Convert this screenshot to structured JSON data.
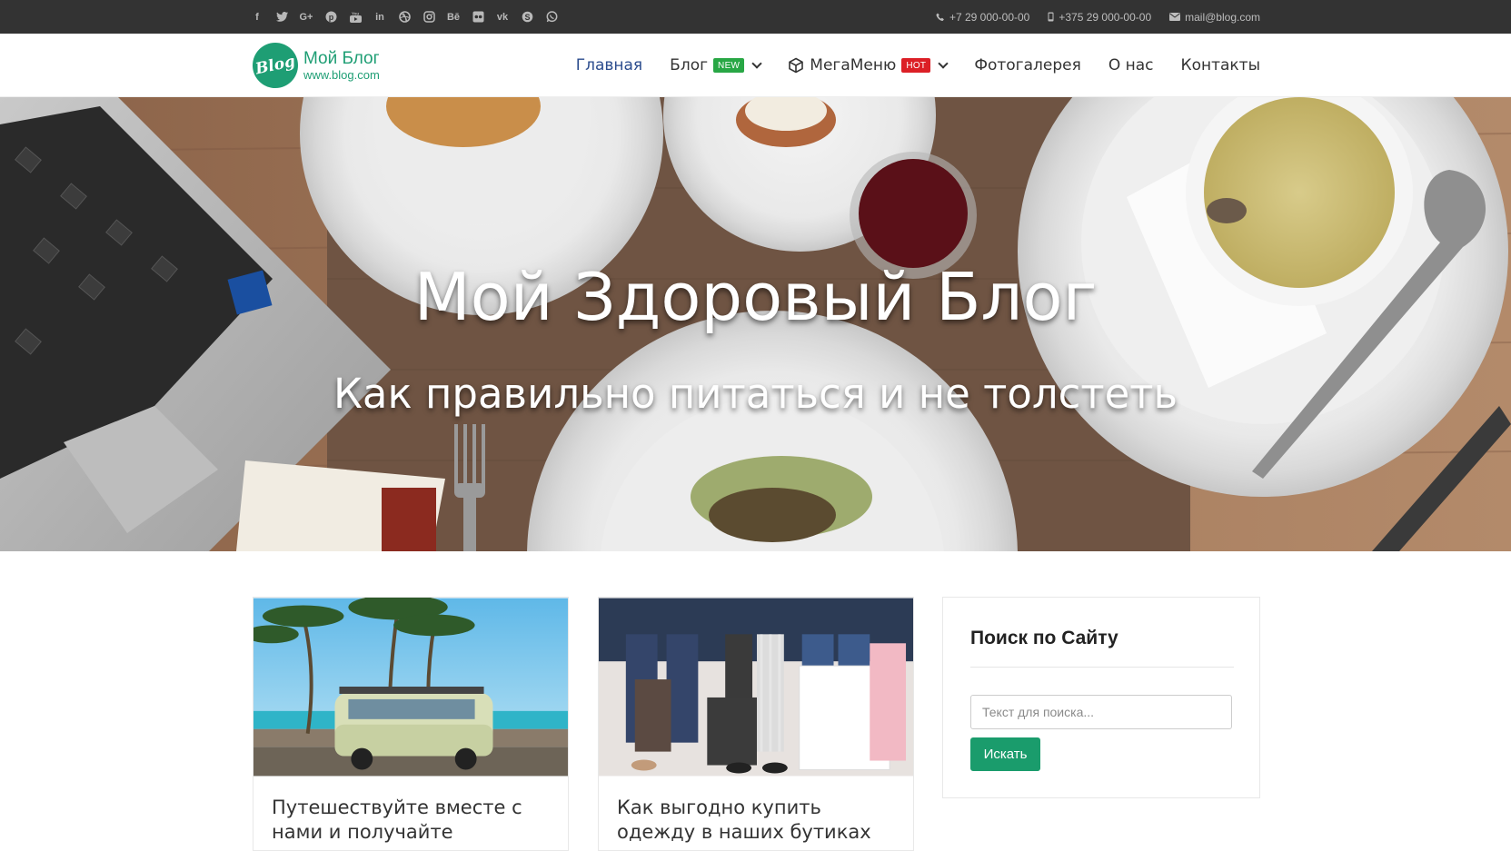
{
  "topbar": {
    "social_icons": [
      {
        "name": "facebook-icon",
        "glyph": "f"
      },
      {
        "name": "twitter-icon",
        "glyph": "🐦"
      },
      {
        "name": "google-plus-icon",
        "glyph": "G+"
      },
      {
        "name": "pinterest-icon",
        "glyph": "ⓟ"
      },
      {
        "name": "youtube-icon",
        "glyph": "▶"
      },
      {
        "name": "linkedin-icon",
        "glyph": "in"
      },
      {
        "name": "dribbble-icon",
        "glyph": "◍"
      },
      {
        "name": "instagram-icon",
        "glyph": "◘"
      },
      {
        "name": "behance-icon",
        "glyph": "Bē"
      },
      {
        "name": "flickr-icon",
        "glyph": "••"
      },
      {
        "name": "vk-icon",
        "glyph": "vk"
      },
      {
        "name": "skype-icon",
        "glyph": "S"
      },
      {
        "name": "whatsapp-icon",
        "glyph": "◔"
      }
    ],
    "phone1": "+7 29 000-00-00",
    "phone2": "+375 29 000-00-00",
    "email": "mail@blog.com"
  },
  "logo": {
    "mark": "Blog",
    "name": "Мой Блог",
    "url": "www.blog.com"
  },
  "menu": {
    "home": "Главная",
    "blog": "Блог",
    "blog_badge": "NEW",
    "mega": "МегаМеню",
    "mega_badge": "HOT",
    "gallery": "Фотогалерея",
    "about": "О нас",
    "contacts": "Контакты"
  },
  "hero": {
    "title": "Мой Здоровый Блог",
    "subtitle": "Как правильно питаться и не толстеть"
  },
  "posts": [
    {
      "title": "Путешествуйте вместе с нами и получайте удовольствие"
    },
    {
      "title": "Как выгодно купить одежду в наших бутиках"
    }
  ],
  "search_widget": {
    "title": "Поиск по Сайту",
    "placeholder": "Текст для поиска...",
    "button": "Искать"
  },
  "colors": {
    "accent": "#1a9c6c",
    "topbar": "#333333",
    "nav_active": "#2a4b8d",
    "badge_new": "#28a745",
    "badge_hot": "#dc1f26"
  }
}
